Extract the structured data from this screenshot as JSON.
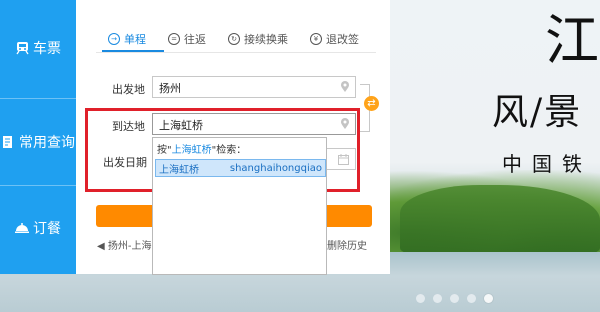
{
  "banner": {
    "big_char": "江",
    "sub_chars": "风/景",
    "tiny_chars": "中国铁",
    "carousel_dots": 5,
    "active_dot": 4
  },
  "sidebar": {
    "items": [
      {
        "label": "车票",
        "icon": "train-icon"
      },
      {
        "label": "常用查询",
        "icon": "document-icon"
      },
      {
        "label": "订餐",
        "icon": "dish-icon"
      }
    ]
  },
  "tabs": [
    {
      "label": "单程",
      "icon": "arrow-circle-icon",
      "active": true
    },
    {
      "label": "往返",
      "icon": "equal-circle-icon",
      "active": false
    },
    {
      "label": "接续换乘",
      "icon": "refresh-circle-icon",
      "active": false
    },
    {
      "label": "退改签",
      "icon": "refund-circle-icon",
      "active": false
    }
  ],
  "form": {
    "from_label": "出发地",
    "from_value": "扬州",
    "to_label": "到达地",
    "to_value": "上海虹桥",
    "date_label": "出发日期"
  },
  "dropdown": {
    "hint_prefix": "按\"",
    "hint_query": "上海虹桥",
    "hint_suffix": "\"检索：",
    "result_name": "上海虹桥",
    "result_pinyin": "shanghaihongqiao"
  },
  "history": {
    "text": "◀ 扬州-上海",
    "delete_label": "删除历史"
  },
  "colors": {
    "accent_blue": "#1fa0f0",
    "tab_active": "#1a8ae0",
    "orange": "#ff8a00",
    "highlight_red": "#e0202a"
  }
}
